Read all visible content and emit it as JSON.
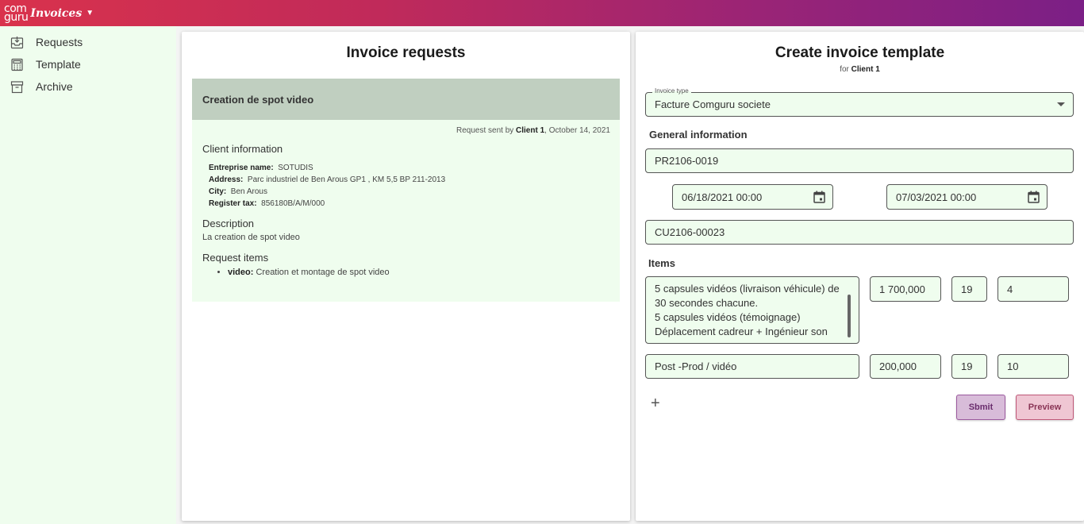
{
  "app": {
    "logo_line1": "com",
    "logo_line2": "guru",
    "name": "Invoices"
  },
  "sidebar": {
    "items": [
      {
        "label": "Requests",
        "icon": "inbox-download-icon"
      },
      {
        "label": "Template",
        "icon": "calculator-icon"
      },
      {
        "label": "Archive",
        "icon": "archive-box-icon"
      }
    ]
  },
  "requests": {
    "title": "Invoice requests",
    "card": {
      "title": "Creation de spot video",
      "sent_prefix": "Request sent by ",
      "sent_by": "Client 1",
      "sent_date": ", October 14, 2021",
      "client_info_title": "Client information",
      "info": [
        {
          "key": "Entreprise name:",
          "value": "SOTUDIS"
        },
        {
          "key": "Address:",
          "value": "Parc industriel de Ben Arous GP1 , KM 5,5 BP 211-2013"
        },
        {
          "key": "City:",
          "value": "Ben Arous"
        },
        {
          "key": "Register tax:",
          "value": "856180B/A/M/000"
        }
      ],
      "description_title": "Description",
      "description": "La creation de spot video",
      "items_title": "Request items",
      "items": [
        {
          "name": "video:",
          "text": "Creation et montage de spot video"
        }
      ]
    }
  },
  "template": {
    "title": "Create invoice template",
    "for_prefix": "for ",
    "for_client": "Client 1",
    "invoice_type_label": "Invoice type",
    "invoice_type_value": "Facture Comguru societe",
    "general_title": "General information",
    "ref1": "PR2106-0019",
    "date_start": "06/18/2021 00:00",
    "date_end": "07/03/2021 00:00",
    "ref2": "CU2106-00023",
    "items_title": "Items",
    "items": [
      {
        "desc_lines": [
          "5 capsules vidéos (livraison véhicule) de",
          "30 secondes chacune.",
          "5 capsules vidéos (témoignage)",
          "Déplacement cadreur + Ingénieur son"
        ],
        "price": "1 700,000",
        "tax": "19",
        "qty": "4"
      },
      {
        "desc": "Post -Prod / vidéo",
        "price": "200,000",
        "tax": "19",
        "qty": "10"
      }
    ],
    "add_symbol": "+",
    "submit_label": "Sbmit",
    "preview_label": "Preview"
  }
}
